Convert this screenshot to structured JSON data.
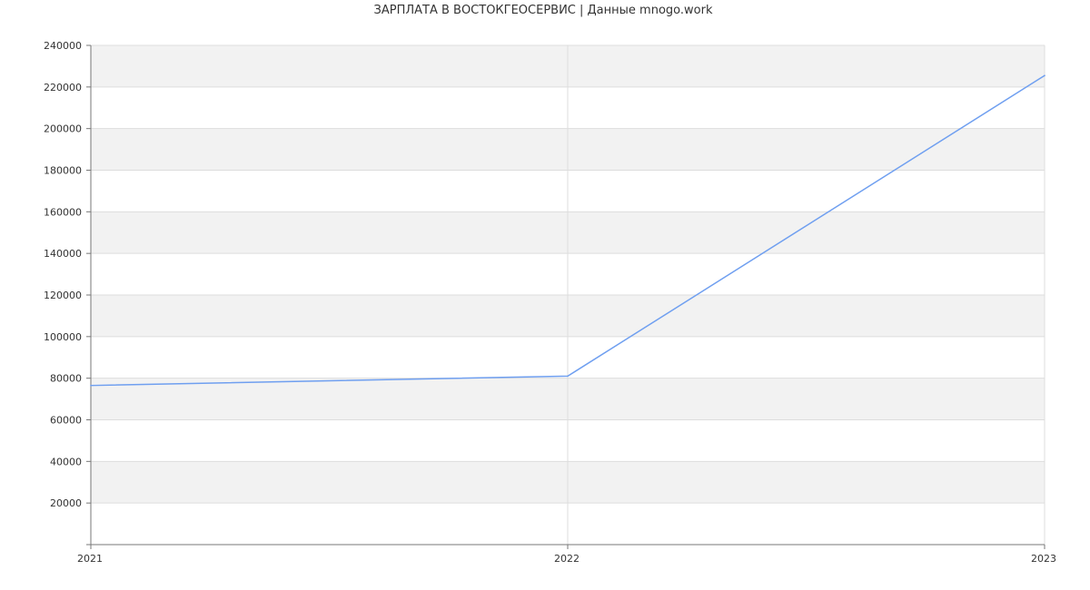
{
  "chart_data": {
    "type": "line",
    "title": "ЗАРПЛАТА В ВОСТОКГЕОСЕРВИС | Данные mnogo.work",
    "xlabel": "",
    "ylabel": "",
    "categories": [
      "2021",
      "2022",
      "2023"
    ],
    "series": [
      {
        "values": [
          76500,
          81000,
          225500
        ],
        "color": "#6f9ff0"
      }
    ],
    "ylim": [
      0,
      240000
    ],
    "yticks": [
      20000,
      40000,
      60000,
      80000,
      100000,
      120000,
      140000,
      160000,
      180000,
      200000,
      220000,
      240000
    ],
    "ytick_labels": [
      "20000",
      "40000",
      "60000",
      "80000",
      "100000",
      "120000",
      "140000",
      "160000",
      "180000",
      "200000",
      "220000",
      "240000"
    ],
    "grid": true,
    "band_colors": [
      "#ffffff",
      "#f2f2f2"
    ],
    "grid_color": "#dddddd",
    "axis_color": "#777777",
    "legend": "none"
  }
}
